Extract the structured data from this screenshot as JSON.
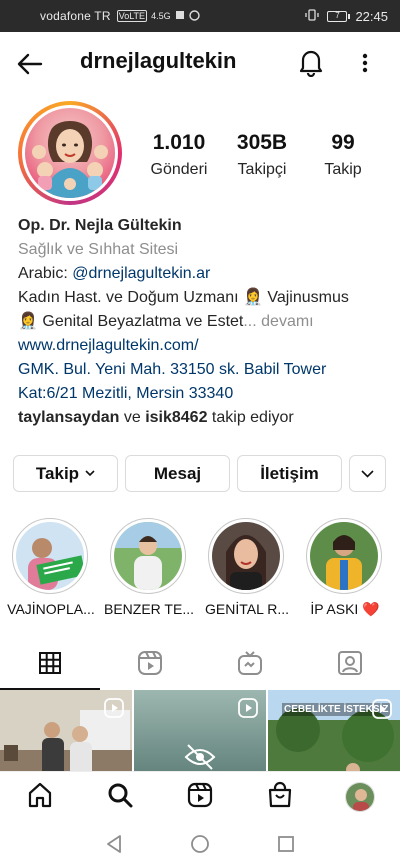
{
  "status_bar": {
    "carrier": "vodafone TR",
    "network": "VoLTE",
    "signal": "4.5G",
    "battery": "7",
    "time": "22:45"
  },
  "header": {
    "username": "drnejlagultekin"
  },
  "profile": {
    "stats": [
      {
        "value": "1.010",
        "label": "Gönderi"
      },
      {
        "value": "305B",
        "label": "Takipçi"
      },
      {
        "value": "99",
        "label": "Takip"
      }
    ],
    "name": "Op. Dr. Nejla Gültekin",
    "category": "Sağlık ve Sıhhat Sitesi",
    "arabic_prefix": "Arabic: ",
    "arabic_handle": "@drnejlagultekin.ar",
    "bio_line1": "Kadın Hast. ve Doğum Uzmanı 👩‍⚕️ Vajinusmus",
    "bio_line2": "👩‍⚕️ Genital Beyazlatma ve Estet",
    "bio_more": "... devamı",
    "website": "www.drnejlagultekin.com/",
    "address_line1": "GMK. Bul. Yeni Mah. 33150 sk. Babil Tower",
    "address_line2": "Kat:6/21 Mezitli, Mersin 33340",
    "followed_by_1": "taylansaydan",
    "followed_by_and": " ve ",
    "followed_by_2": "isik8462",
    "followed_by_suffix": " takip ediyor"
  },
  "actions": {
    "follow": "Takip",
    "message": "Mesaj",
    "contact": "İletişim"
  },
  "highlights": [
    {
      "label": "VAJİNOPLA..."
    },
    {
      "label": "BENZER TE..."
    },
    {
      "label": "GENİTAL R..."
    },
    {
      "label": "İP ASKI ❤️"
    }
  ],
  "grid": {
    "post3_caption": "CEBELİKTE İSTEKSİZ"
  },
  "colors": {
    "link": "#00376b",
    "secondary": "#8e8e8e",
    "border": "#dbdbdb",
    "like_red": "#ed4956"
  }
}
